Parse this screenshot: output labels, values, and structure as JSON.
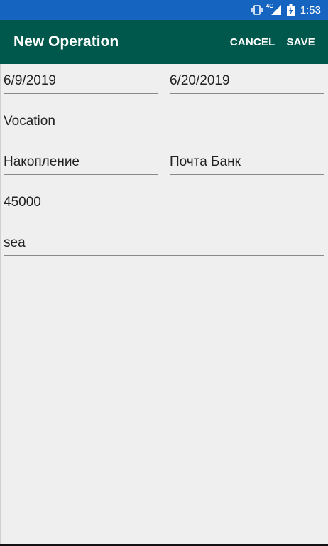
{
  "status_bar": {
    "time": "1:53",
    "network_label": "4G",
    "icons": [
      "vibrate-icon",
      "signal-icon",
      "battery-charging-icon"
    ]
  },
  "app_bar": {
    "title": "New Operation",
    "cancel_label": "CANCEL",
    "save_label": "SAVE"
  },
  "form": {
    "start_date": "6/9/2019",
    "end_date": "6/20/2019",
    "name": "Vocation",
    "category": "Накопление",
    "account": "Почта Банк",
    "amount": "45000",
    "comment": "sea"
  },
  "colors": {
    "status_bar": "#1565c0",
    "app_bar": "#00574b",
    "background": "#efefef",
    "underline": "#8a8a8a"
  }
}
